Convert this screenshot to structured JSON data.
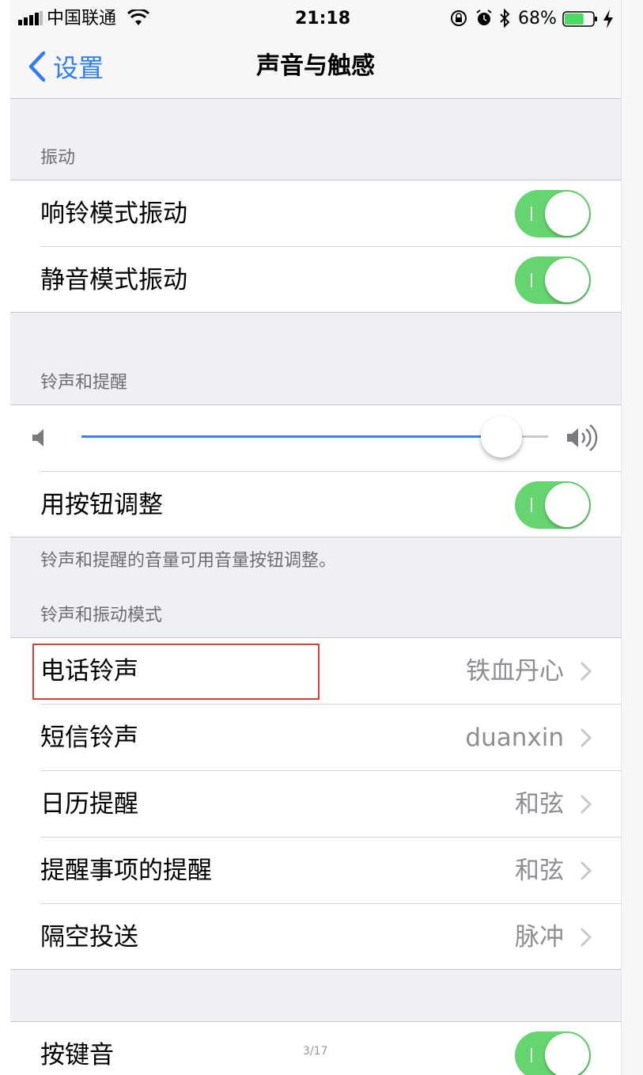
{
  "status_bar": {
    "carrier": "中国联通",
    "time": "21:18",
    "battery_percent": "68%",
    "battery_level": 0.68
  },
  "nav": {
    "back_label": "设置",
    "title": "声音与触感"
  },
  "vibration": {
    "header": "振动",
    "rows": [
      {
        "label": "响铃模式振动",
        "on": true
      },
      {
        "label": "静音模式振动",
        "on": true
      }
    ]
  },
  "ringer": {
    "header": "铃声和提醒",
    "volume_level": 0.9,
    "buttons_row": {
      "label": "用按钮调整",
      "on": true
    },
    "footer": "铃声和提醒的音量可用音量按钮调整。"
  },
  "patterns": {
    "header": "铃声和振动模式",
    "rows": [
      {
        "label": "电话铃声",
        "value": "铁血丹心"
      },
      {
        "label": "短信铃声",
        "value": "duanxin"
      },
      {
        "label": "日历提醒",
        "value": "和弦"
      },
      {
        "label": "提醒事项的提醒",
        "value": "和弦"
      },
      {
        "label": "隔空投送",
        "value": "脉冲"
      }
    ]
  },
  "keyboard": {
    "row": {
      "label": "按键音",
      "on": true
    }
  },
  "page_indicator": "3/17",
  "colors": {
    "accent_blue": "#2f7cf6",
    "toggle_green": "#65d66f",
    "highlight_red": "#d9413b"
  }
}
